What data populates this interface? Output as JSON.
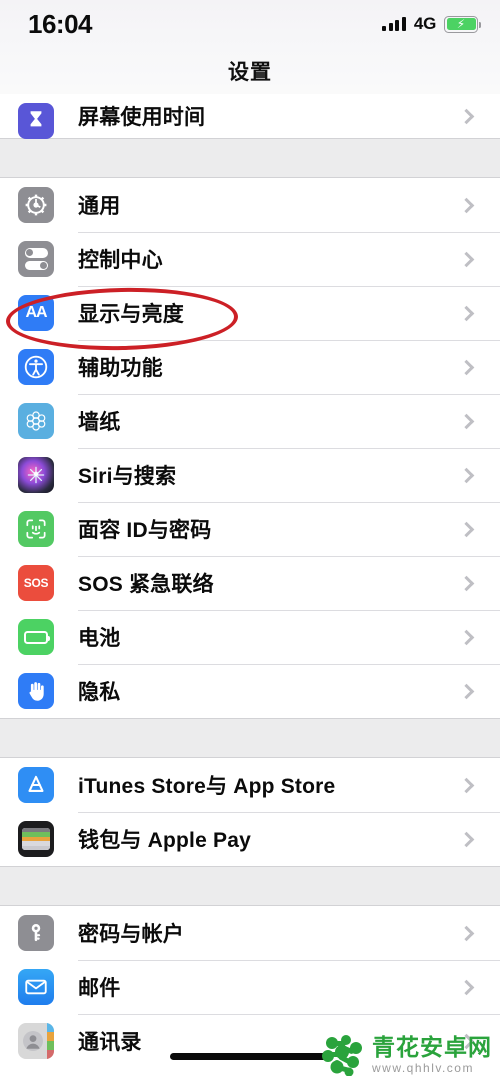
{
  "status_bar": {
    "time": "16:04",
    "network": "4G",
    "signal_icon": "signal-bars-icon",
    "battery_icon": "battery-charging-icon",
    "battery_charging": true
  },
  "nav": {
    "title": "设置"
  },
  "sections": [
    {
      "id": "screen-time",
      "partial_top": true,
      "rows": [
        {
          "label": "屏幕使用时间",
          "icon": "hourglass-icon",
          "icon_class": "ic-screentime",
          "chevron": "chevron-right-icon"
        }
      ]
    },
    {
      "id": "system",
      "rows": [
        {
          "label": "通用",
          "icon": "gear-icon",
          "icon_class": "ic-general",
          "chevron": "chevron-right-icon"
        },
        {
          "label": "控制中心",
          "icon": "sliders-icon",
          "icon_class": "ic-control",
          "chevron": "chevron-right-icon"
        },
        {
          "label": "显示与亮度",
          "icon": "aa-text-icon",
          "icon_class": "ic-display",
          "chevron": "chevron-right-icon",
          "highlighted": true
        },
        {
          "label": "辅助功能",
          "icon": "accessibility-icon",
          "icon_class": "ic-access",
          "chevron": "chevron-right-icon"
        },
        {
          "label": "墙纸",
          "icon": "flower-icon",
          "icon_class": "ic-wallpaper",
          "chevron": "chevron-right-icon"
        },
        {
          "label": "Siri与搜索",
          "icon": "siri-orb-icon",
          "icon_class": "ic-siri",
          "chevron": "chevron-right-icon"
        },
        {
          "label": "面容 ID与密码",
          "icon": "face-id-icon",
          "icon_class": "ic-faceid",
          "chevron": "chevron-right-icon"
        },
        {
          "label": "SOS 紧急联络",
          "icon": "sos-icon",
          "icon_class": "ic-sos",
          "chevron": "chevron-right-icon"
        },
        {
          "label": "电池",
          "icon": "battery-icon",
          "icon_class": "ic-battery",
          "chevron": "chevron-right-icon"
        },
        {
          "label": "隐私",
          "icon": "hand-icon",
          "icon_class": "ic-privacy",
          "chevron": "chevron-right-icon"
        }
      ]
    },
    {
      "id": "stores",
      "rows": [
        {
          "label": "iTunes Store与 App Store",
          "icon": "app-store-icon",
          "icon_class": "ic-appstore",
          "chevron": "chevron-right-icon"
        },
        {
          "label": "钱包与 Apple Pay",
          "icon": "wallet-icon",
          "icon_class": "ic-wallet",
          "chevron": "chevron-right-icon"
        }
      ]
    },
    {
      "id": "accounts",
      "rows": [
        {
          "label": "密码与帐户",
          "icon": "key-icon",
          "icon_class": "ic-password",
          "chevron": "chevron-right-icon"
        },
        {
          "label": "邮件",
          "icon": "envelope-icon",
          "icon_class": "ic-mail",
          "chevron": "chevron-right-icon"
        },
        {
          "label": "通讯录",
          "icon": "contacts-icon",
          "icon_class": "ic-contacts",
          "chevron": "chevron-right-icon"
        }
      ]
    }
  ],
  "annotation": {
    "type": "ellipse-highlight",
    "target_label": "显示与亮度",
    "color": "#cc2026"
  },
  "watermark": {
    "title": "青花安卓网",
    "url": "www.qhhlv.com",
    "logo_color": "#2aa33c"
  },
  "home_indicator": {
    "visible": true
  }
}
